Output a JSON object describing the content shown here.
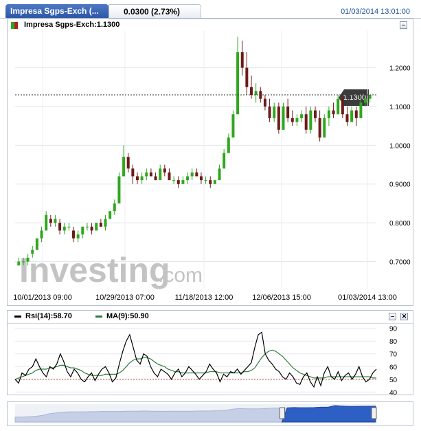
{
  "tab": {
    "label": "Impresa Sgps-Exch (...",
    "change": "0.0300 (2.73%)",
    "datetime": "01/03/2014 13:01:00"
  },
  "main_panel": {
    "legend": "Impresa Sgps-Exch:1.1300",
    "price_tag": "1.1300",
    "watermark_main": "Investing",
    "watermark_suffix": ".com"
  },
  "rsi_panel": {
    "rsi_label": "Rsi(14):58.70",
    "ma_label": "MA(9):50.90"
  },
  "colors": {
    "up": "#2fa81e",
    "down": "#6d1a1a",
    "rsi_line": "#000000",
    "ma_line": "#2b7a3a",
    "navigator_fill": "#2d5fc4",
    "tab": "#2a55a3"
  },
  "icons": [
    "minimize-icon",
    "close-icon",
    "candle-legend-icon",
    "scroll-handle-icon"
  ],
  "chart_data": [
    {
      "type": "candlestick",
      "title": "Impresa Sgps-Exch:1.1300",
      "x_tick_labels": [
        "10/01/2013 09:00",
        "10/29/2013 07:00",
        "11/18/2013 12:00",
        "12/06/2013 15:00",
        "01/03/2014 13:00"
      ],
      "y_ticks": [
        0.7,
        0.8,
        0.9,
        1.0,
        1.1,
        1.2
      ],
      "y_tick_labels": [
        "0.7000",
        "0.8000",
        "0.9000",
        "1.0000",
        "1.1000",
        "1.2000"
      ],
      "ylim": [
        0.63,
        1.295
      ],
      "last_price": 1.13,
      "grid": true,
      "candles_ohlc": [
        [
          0.69,
          0.71,
          0.69,
          0.7
        ],
        [
          0.7,
          0.71,
          0.69,
          0.7
        ],
        [
          0.7,
          0.72,
          0.69,
          0.71
        ],
        [
          0.72,
          0.74,
          0.71,
          0.73
        ],
        [
          0.73,
          0.76,
          0.73,
          0.76
        ],
        [
          0.76,
          0.79,
          0.75,
          0.78
        ],
        [
          0.78,
          0.83,
          0.78,
          0.82
        ],
        [
          0.81,
          0.82,
          0.79,
          0.8
        ],
        [
          0.8,
          0.82,
          0.79,
          0.81
        ],
        [
          0.8,
          0.81,
          0.77,
          0.78
        ],
        [
          0.78,
          0.8,
          0.77,
          0.79
        ],
        [
          0.79,
          0.8,
          0.78,
          0.79
        ],
        [
          0.78,
          0.79,
          0.75,
          0.76
        ],
        [
          0.76,
          0.78,
          0.75,
          0.77
        ],
        [
          0.77,
          0.79,
          0.76,
          0.79
        ],
        [
          0.79,
          0.8,
          0.78,
          0.79
        ],
        [
          0.79,
          0.8,
          0.77,
          0.78
        ],
        [
          0.78,
          0.8,
          0.78,
          0.8
        ],
        [
          0.8,
          0.81,
          0.79,
          0.79
        ],
        [
          0.79,
          0.82,
          0.78,
          0.81
        ],
        [
          0.81,
          0.83,
          0.81,
          0.83
        ],
        [
          0.83,
          0.86,
          0.82,
          0.85
        ],
        [
          0.85,
          0.93,
          0.85,
          0.92
        ],
        [
          0.92,
          1.0,
          0.92,
          0.97
        ],
        [
          0.97,
          0.98,
          0.93,
          0.94
        ],
        [
          0.94,
          0.95,
          0.9,
          0.92
        ],
        [
          0.92,
          0.93,
          0.9,
          0.91
        ],
        [
          0.91,
          0.93,
          0.9,
          0.92
        ],
        [
          0.92,
          0.94,
          0.91,
          0.93
        ],
        [
          0.93,
          0.94,
          0.92,
          0.92
        ],
        [
          0.92,
          0.93,
          0.91,
          0.91
        ],
        [
          0.91,
          0.95,
          0.91,
          0.94
        ],
        [
          0.94,
          0.95,
          0.92,
          0.93
        ],
        [
          0.93,
          0.94,
          0.91,
          0.91
        ],
        [
          0.91,
          0.92,
          0.9,
          0.91
        ],
        [
          0.91,
          0.92,
          0.89,
          0.9
        ],
        [
          0.9,
          0.92,
          0.9,
          0.91
        ],
        [
          0.91,
          0.93,
          0.9,
          0.92
        ],
        [
          0.92,
          0.94,
          0.91,
          0.93
        ],
        [
          0.93,
          0.94,
          0.92,
          0.92
        ],
        [
          0.92,
          0.93,
          0.9,
          0.91
        ],
        [
          0.91,
          0.92,
          0.9,
          0.91
        ],
        [
          0.91,
          0.92,
          0.89,
          0.9
        ],
        [
          0.9,
          0.91,
          0.9,
          0.91
        ],
        [
          0.91,
          0.95,
          0.91,
          0.94
        ],
        [
          0.94,
          0.99,
          0.94,
          0.98
        ],
        [
          0.98,
          1.03,
          0.98,
          1.02
        ],
        [
          1.02,
          1.09,
          1.02,
          1.08
        ],
        [
          1.08,
          1.28,
          1.08,
          1.24
        ],
        [
          1.24,
          1.27,
          1.18,
          1.2
        ],
        [
          1.2,
          1.24,
          1.13,
          1.15
        ],
        [
          1.15,
          1.18,
          1.12,
          1.13
        ],
        [
          1.13,
          1.16,
          1.11,
          1.14
        ],
        [
          1.14,
          1.15,
          1.11,
          1.12
        ],
        [
          1.12,
          1.13,
          1.09,
          1.1
        ],
        [
          1.1,
          1.12,
          1.06,
          1.07
        ],
        [
          1.07,
          1.11,
          1.06,
          1.1
        ],
        [
          1.1,
          1.11,
          1.03,
          1.04
        ],
        [
          1.04,
          1.11,
          1.04,
          1.1
        ],
        [
          1.1,
          1.12,
          1.06,
          1.07
        ],
        [
          1.07,
          1.09,
          1.05,
          1.06
        ],
        [
          1.06,
          1.08,
          1.05,
          1.07
        ],
        [
          1.07,
          1.09,
          1.06,
          1.08
        ],
        [
          1.08,
          1.1,
          1.03,
          1.04
        ],
        [
          1.04,
          1.1,
          1.03,
          1.09
        ],
        [
          1.09,
          1.1,
          1.06,
          1.07
        ],
        [
          1.07,
          1.09,
          1.01,
          1.02
        ],
        [
          1.02,
          1.08,
          1.02,
          1.07
        ],
        [
          1.07,
          1.1,
          1.05,
          1.09
        ],
        [
          1.09,
          1.11,
          1.07,
          1.08
        ],
        [
          1.08,
          1.13,
          1.08,
          1.12
        ],
        [
          1.12,
          1.13,
          1.07,
          1.08
        ],
        [
          1.08,
          1.1,
          1.05,
          1.06
        ],
        [
          1.06,
          1.1,
          1.06,
          1.09
        ],
        [
          1.09,
          1.1,
          1.05,
          1.07
        ],
        [
          1.07,
          1.12,
          1.07,
          1.11
        ],
        [
          1.11,
          1.12,
          1.1,
          1.12
        ],
        [
          1.12,
          1.13,
          1.11,
          1.13
        ]
      ]
    },
    {
      "type": "line",
      "series": [
        {
          "name": "Rsi(14)",
          "values": [
            50,
            47,
            55,
            53,
            58,
            60,
            66,
            60,
            55,
            52,
            60,
            58,
            62,
            70,
            64,
            56,
            52,
            58,
            55,
            50,
            48,
            52,
            55,
            49,
            54,
            58,
            60,
            55,
            48,
            51,
            62,
            72,
            80,
            85,
            75,
            65,
            62,
            70,
            68,
            60,
            55,
            52,
            58,
            56,
            54,
            50,
            55,
            58,
            52,
            55,
            60,
            57,
            54,
            50,
            53,
            56,
            62,
            58,
            55,
            48,
            54,
            52,
            56,
            55,
            58,
            54,
            57,
            60,
            63,
            75,
            85,
            87,
            70,
            65,
            62,
            58,
            56,
            52,
            50,
            55,
            52,
            47,
            46,
            52,
            55,
            48,
            44,
            52,
            45,
            55,
            60,
            52,
            50,
            56,
            49,
            53,
            55,
            50,
            54,
            60,
            52,
            48,
            50,
            55,
            58
          ]
        },
        {
          "name": "MA(9)",
          "values": [
            50,
            51,
            52,
            53,
            54,
            55,
            57,
            58,
            58,
            58,
            59,
            59,
            60,
            61,
            61,
            60,
            59,
            59,
            58,
            57,
            55,
            54,
            53,
            53,
            53,
            53,
            54,
            54,
            54,
            54,
            55,
            57,
            60,
            63,
            65,
            66,
            66,
            67,
            67,
            66,
            64,
            62,
            61,
            60,
            58,
            57,
            56,
            56,
            55,
            55,
            55,
            55,
            55,
            55,
            55,
            55,
            56,
            56,
            56,
            55,
            55,
            55,
            55,
            55,
            55,
            55,
            56,
            56,
            57,
            59,
            63,
            67,
            70,
            72,
            73,
            72,
            70,
            68,
            65,
            62,
            59,
            57,
            55,
            54,
            53,
            52,
            51,
            51,
            51,
            51,
            52,
            52,
            52,
            52,
            52,
            52,
            52,
            52,
            52,
            52,
            52,
            52,
            52,
            51,
            51
          ]
        }
      ],
      "y_ticks": [
        40,
        50,
        60,
        70,
        80,
        90
      ],
      "ylim": [
        38,
        92
      ],
      "reference_line": 50
    },
    {
      "type": "area",
      "name": "navigator",
      "values": [
        0.3,
        0.3,
        0.32,
        0.35,
        0.4,
        0.5,
        0.55,
        0.6,
        0.62,
        0.62,
        0.62,
        0.63,
        0.63,
        0.64,
        0.64,
        0.64,
        0.65,
        0.66,
        0.66,
        0.67,
        0.66,
        0.65,
        0.65,
        0.66,
        0.66,
        0.65,
        0.66,
        0.67,
        0.67,
        0.68,
        0.7,
        0.72,
        0.78,
        0.82,
        0.8,
        0.8,
        0.8,
        0.82,
        0.85,
        0.85,
        0.86,
        0.88,
        0.87,
        0.87,
        0.88,
        0.9,
        0.9,
        1.0,
        0.97,
        0.95,
        0.95,
        0.96,
        0.96,
        0.96
      ],
      "selected_range": [
        0.74,
        1.0
      ]
    }
  ]
}
